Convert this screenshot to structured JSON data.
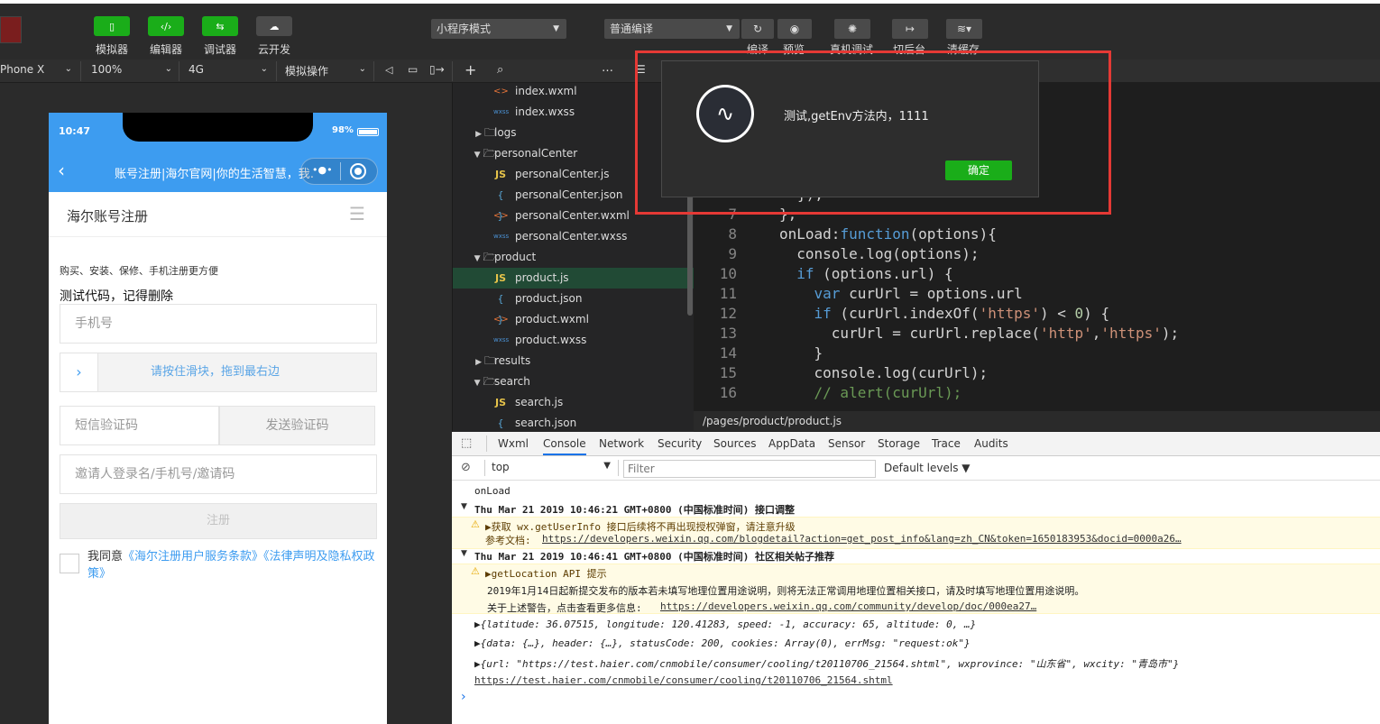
{
  "toolbar": {
    "left_buttons": [
      {
        "label": "模拟器",
        "icon": "phone-icon"
      },
      {
        "label": "编辑器",
        "icon": "code-icon"
      },
      {
        "label": "调试器",
        "icon": "debug-icon"
      },
      {
        "label": "云开发",
        "icon": "cloud-icon"
      }
    ],
    "mode_select": "小程序模式",
    "compile_select": "普通编译",
    "right_buttons": [
      {
        "label": "编译",
        "icon": "refresh-icon"
      },
      {
        "label": "预览",
        "icon": "eye-icon"
      },
      {
        "label": "真机调试",
        "icon": "bug-icon"
      },
      {
        "label": "切后台",
        "icon": "switch-icon"
      },
      {
        "label": "清缓存",
        "icon": "layers-icon"
      }
    ]
  },
  "subbar": {
    "device": "Phone X",
    "zoom": "100%",
    "network": "4G",
    "sim_ops": "模拟操作"
  },
  "phone": {
    "time": "10:47",
    "battery": "98%",
    "nav_title": "账号注册|海尔官网|你的生活智慧，我…",
    "page_title": "海尔账号注册",
    "subtitle": "购买、安装、保修、手机注册更方便",
    "test_text": "测试代码，记得删除",
    "phone_placeholder": "手机号",
    "slider_text": "请按住滑块，拖到最右边",
    "sms_placeholder": "短信验证码",
    "send_code": "发送验证码",
    "invite_placeholder": "邀请人登录名/手机号/邀请码",
    "register": "注册",
    "agree_prefix": "我同意",
    "agree_links": "《海尔注册用户服务条款》《法律声明及隐私权政策》"
  },
  "tree": {
    "items": [
      {
        "name": "index.wxml",
        "type": "wxml",
        "indent": 2
      },
      {
        "name": "index.wxss",
        "type": "wxss",
        "indent": 2
      },
      {
        "name": "logs",
        "type": "folder-closed",
        "indent": 1
      },
      {
        "name": "personalCenter",
        "type": "folder-open",
        "indent": 1
      },
      {
        "name": "personalCenter.js",
        "type": "js",
        "indent": 2
      },
      {
        "name": "personalCenter.json",
        "type": "json",
        "indent": 2
      },
      {
        "name": "personalCenter.wxml",
        "type": "wxml",
        "indent": 2
      },
      {
        "name": "personalCenter.wxss",
        "type": "wxss",
        "indent": 2
      },
      {
        "name": "product",
        "type": "folder-open",
        "indent": 1
      },
      {
        "name": "product.js",
        "type": "js",
        "indent": 2,
        "selected": true
      },
      {
        "name": "product.json",
        "type": "json",
        "indent": 2
      },
      {
        "name": "product.wxml",
        "type": "wxml",
        "indent": 2
      },
      {
        "name": "product.wxss",
        "type": "wxss",
        "indent": 2
      },
      {
        "name": "results",
        "type": "folder-closed",
        "indent": 1
      },
      {
        "name": "search",
        "type": "folder-open",
        "indent": 1
      },
      {
        "name": "search.js",
        "type": "js",
        "indent": 2
      },
      {
        "name": "search.json",
        "type": "json",
        "indent": 2
      }
    ]
  },
  "editor": {
    "file_path": "/pages/product/product.js",
    "lines": [
      {
        "n": "",
        "html": "  <span>},</span>"
      },
      {
        "n": "7",
        "html": "},"
      },
      {
        "n": "8",
        "html": "onLoad:<span class='kw'>function</span>(options){"
      },
      {
        "n": "9",
        "html": "  console.log(options);"
      },
      {
        "n": "10",
        "html": "  <span class='kw'>if</span> (options.url) {"
      },
      {
        "n": "11",
        "html": "    <span class='kw'>var</span> curUrl = options.url"
      },
      {
        "n": "12",
        "html": "    <span class='kw'>if</span> (curUrl.indexOf(<span class='str'>'https'</span>) &lt; <span class='num'>0</span>) {"
      },
      {
        "n": "13",
        "html": "      curUrl = curUrl.replace(<span class='str'>'http'</span>,<span class='str'>'https'</span>);"
      },
      {
        "n": "14",
        "html": "    }"
      },
      {
        "n": "15",
        "html": "    console.log(curUrl);"
      },
      {
        "n": "16",
        "html": "    <span class='cm'>// alert(curUrl);</span>"
      }
    ]
  },
  "dialog": {
    "message": "测试,getEnv方法内，1111",
    "ok": "确定"
  },
  "devtools": {
    "tabs": [
      "Wxml",
      "Console",
      "Network",
      "Security",
      "Sources",
      "AppData",
      "Sensor",
      "Storage",
      "Trace",
      "Audits"
    ],
    "active_tab": "Console",
    "context": "top",
    "filter_placeholder": "Filter",
    "levels": "Default levels ▼",
    "logs": {
      "l1": "onLoad",
      "l2": "Thu Mar 21 2019 10:46:21 GMT+0800 (中国标准时间) 接口调整",
      "l3": "▶获取 wx.getUserInfo 接口后续将不再出现授权弹窗，请注意升级",
      "l4a": "参考文档: ",
      "l4b": "https://developers.weixin.qq.com/blogdetail?action=get_post_info&lang=zh_CN&token=1650183953&docid=0000a26…",
      "l5": "Thu Mar 21 2019 10:46:41 GMT+0800 (中国标准时间) 社区相关帖子推荐",
      "l6": "▶getLocation API 提示",
      "l7": "2019年1月14日起新提交发布的版本若未填写地理位置用途说明，则将无法正常调用地理位置相关接口，请及时填写地理位置用途说明。",
      "l8a": "关于上述警告，点击查看更多信息: ",
      "l8b": "https://developers.weixin.qq.com/community/develop/doc/000ea27…",
      "l9": "▶{latitude: 36.07515, longitude: 120.41283, speed: -1, accuracy: 65, altitude: 0, …}",
      "l10": "▶{data: {…}, header: {…}, statusCode: 200, cookies: Array(0), errMsg: \"request:ok\"}",
      "l11": "▶{url: \"https://test.haier.com/cnmobile/consumer/cooling/t20110706_21564.shtml\", wxprovince: \"山东省\", wxcity: \"青岛市\"}",
      "l12": "https://test.haier.com/cnmobile/consumer/cooling/t20110706_21564.shtml",
      "prompt": "›"
    }
  }
}
